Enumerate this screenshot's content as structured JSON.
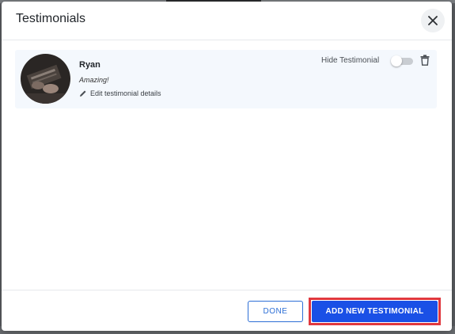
{
  "modal": {
    "title": "Testimonials"
  },
  "testimonial": {
    "name": "Ryan",
    "quote": "Amazing!",
    "edit_label": "Edit testimonial details",
    "hide_label": "Hide Testimonial",
    "hidden": false
  },
  "footer": {
    "done_label": "DONE",
    "add_label": "ADD NEW TESTIMONIAL"
  },
  "colors": {
    "primary": "#1a50e6",
    "outline_highlight": "#e0383e",
    "card_background": "#f4f8fd"
  },
  "icons": [
    "close-icon",
    "pencil-icon",
    "trash-icon"
  ]
}
